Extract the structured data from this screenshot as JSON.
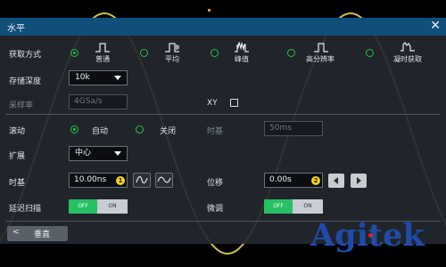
{
  "dialog": {
    "title": "水平",
    "close_glyph": "✕"
  },
  "acquire": {
    "label": "获取方式",
    "modes": [
      {
        "label": "普通",
        "icon": "normal-acquire-icon",
        "selected": true
      },
      {
        "label": "平均",
        "icon": "average-acquire-icon",
        "selected": false
      },
      {
        "label": "峰值",
        "icon": "peak-acquire-icon",
        "selected": false
      },
      {
        "label": "高分辨率",
        "icon": "high-res-acquire-icon",
        "selected": false
      },
      {
        "label": "凝时获取",
        "icon": "timed-acquire-icon",
        "selected": false
      }
    ]
  },
  "memory_depth": {
    "label": "存储深度",
    "value": "10k"
  },
  "sample_rate": {
    "label": "采样率",
    "value": "4GSa/s"
  },
  "xy": {
    "label": "XY",
    "checked": false
  },
  "roll": {
    "label": "滚动",
    "options": [
      "自动",
      "关闭"
    ],
    "selected": "自动",
    "timebase_label": "时基",
    "timebase_value": "50ms"
  },
  "expand": {
    "label": "扩展",
    "value": "中心"
  },
  "timebase": {
    "label": "时基",
    "value": "10.00ns",
    "knob": "1"
  },
  "offset": {
    "label": "位移",
    "value": "0.00s",
    "knob": "2"
  },
  "delay_scan": {
    "label": "延迟扫描",
    "off": "OFF",
    "on": "ON"
  },
  "fine": {
    "label": "微调",
    "off": "OFF",
    "on": "ON"
  },
  "back": {
    "label": "垂直",
    "arrow": "<"
  },
  "logo": {
    "text": "Agitek"
  },
  "colors": {
    "accent": "#22c24a",
    "titlebar": "#0f4f7a",
    "badge": "#f2d21b",
    "trace": "#c8c24a",
    "logo": "#1e4ba8"
  }
}
